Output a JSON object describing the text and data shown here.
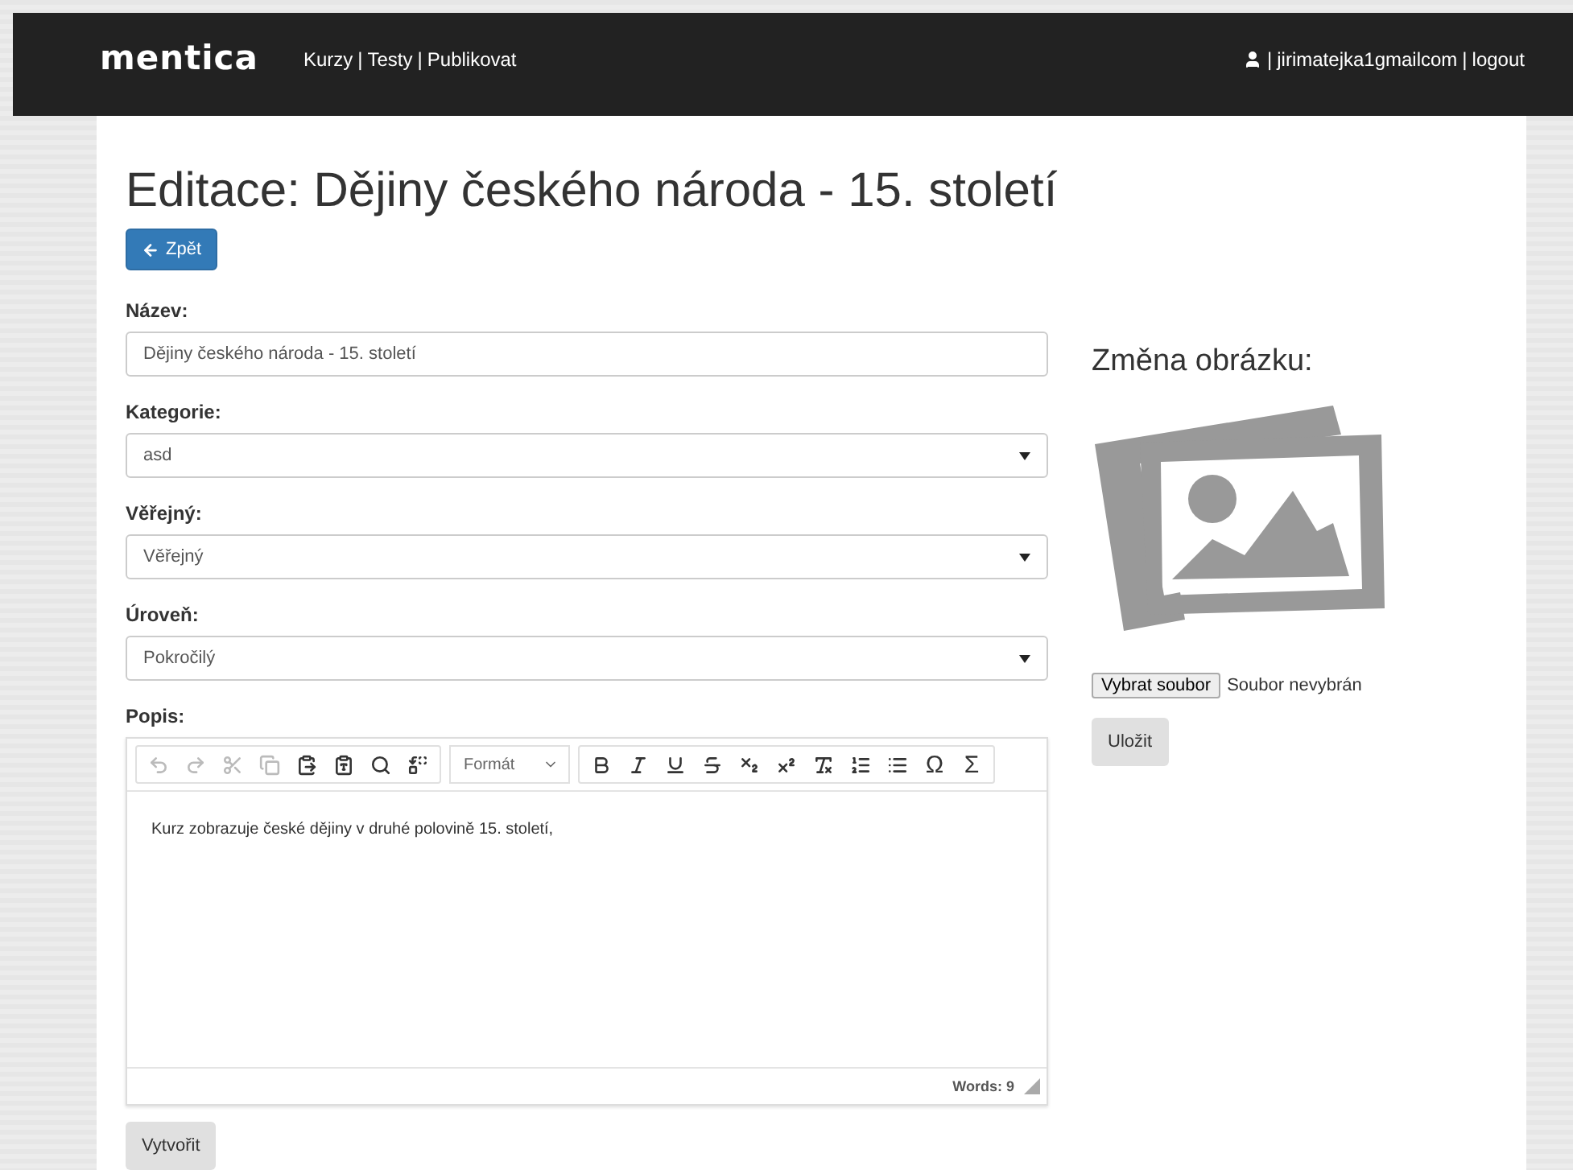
{
  "navbar": {
    "brand": "mentica",
    "separator": "|",
    "links": [
      "Kurzy",
      "Testy",
      "Publikovat"
    ],
    "user": "jirimatejka1gmailcom",
    "logout": "logout"
  },
  "title": "Editace: Dějiny českého národa - 15. století",
  "back_button": "Zpět",
  "fields": [
    {
      "kind": "input",
      "label": "Název:",
      "value": "Dějiny českého národa - 15. století"
    },
    {
      "kind": "select",
      "label": "Kategorie:",
      "value": "asd"
    },
    {
      "kind": "select",
      "label": "Věřejný:",
      "value": "Věřejný"
    },
    {
      "kind": "select",
      "label": "Úroveň:",
      "value": "Pokročilý"
    }
  ],
  "editor": {
    "label": "Popis:",
    "format": "Formát",
    "groups": [
      [
        {
          "disabled": true
        },
        {
          "disabled": true
        },
        {
          "disabled": true
        },
        {
          "disabled": true
        },
        {
          "disabled": false
        },
        {
          "disabled": false
        },
        {
          "disabled": false
        },
        {
          "disabled": false
        }
      ],
      [
        {
          "disabled": false
        },
        {
          "disabled": false
        },
        {
          "disabled": false
        },
        {
          "disabled": false
        },
        {
          "disabled": false
        },
        {
          "disabled": false
        },
        {
          "disabled": false
        },
        {
          "disabled": false
        },
        {
          "disabled": false
        },
        {
          "label": "Ω",
          "disabled": false
        },
        {
          "label": "Σ",
          "disabled": false
        }
      ]
    ],
    "content": "Kurz zobrazuje české dějiny v druhé polovině 15. století,",
    "word_count": "Words: 9"
  },
  "create_button": "Vytvořit",
  "image_panel": {
    "title": "Změna obrázku:",
    "file_button": "Vybrat soubor",
    "file_status": "Soubor nevybrán",
    "save_button": "Uložit"
  }
}
